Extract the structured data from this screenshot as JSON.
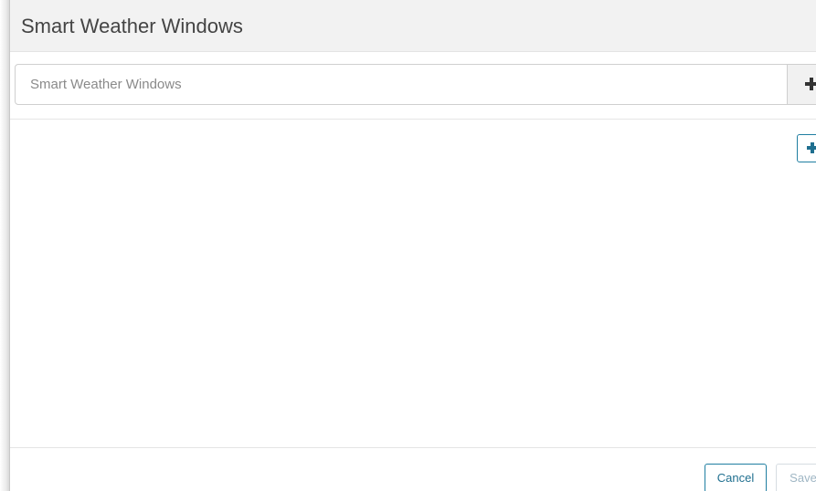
{
  "dialog": {
    "title": "Smart Weather Windows"
  },
  "name_field": {
    "value": "",
    "placeholder": "Smart Weather Windows",
    "addon_icon": "plus-icon"
  },
  "content": {
    "add_button_icon": "plus-icon"
  },
  "footer": {
    "cancel_label": "Cancel",
    "save_label": "Save",
    "save_enabled": false
  },
  "colors": {
    "accent": "#1f7ea1",
    "header_bg": "#f2f2f2",
    "disabled_text": "#9fb6c4"
  }
}
